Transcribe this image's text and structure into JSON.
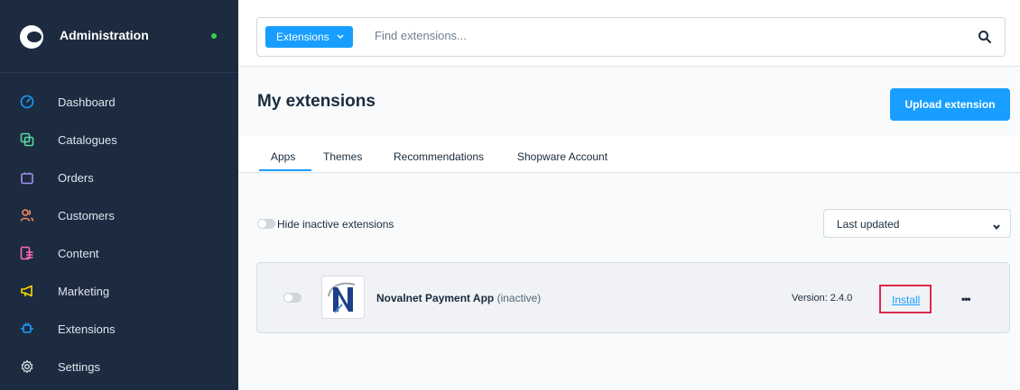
{
  "sidebar": {
    "title": "Administration",
    "status_color": "#37d046",
    "items": [
      {
        "label": "Dashboard",
        "icon": "dashboard-icon",
        "color": "#189eff"
      },
      {
        "label": "Catalogues",
        "icon": "catalogue-icon",
        "color": "#57d9a3"
      },
      {
        "label": "Orders",
        "icon": "orders-icon",
        "color": "#a092f0"
      },
      {
        "label": "Customers",
        "icon": "customers-icon",
        "color": "#f88962"
      },
      {
        "label": "Content",
        "icon": "content-icon",
        "color": "#ff68b4"
      },
      {
        "label": "Marketing",
        "icon": "marketing-icon",
        "color": "#ffd700"
      },
      {
        "label": "Extensions",
        "icon": "extensions-icon",
        "color": "#189eff"
      },
      {
        "label": "Settings",
        "icon": "settings-icon",
        "color": "#d1d9e0"
      }
    ]
  },
  "search": {
    "scope_label": "Extensions",
    "placeholder": "Find extensions..."
  },
  "page": {
    "title": "My extensions",
    "upload_label": "Upload extension",
    "tabs": [
      "Apps",
      "Themes",
      "Recommendations",
      "Shopware Account"
    ],
    "active_tab": "Apps",
    "hide_inactive_label": "Hide inactive extensions",
    "sort_value": "Last updated"
  },
  "extension": {
    "name": "Novalnet Payment App",
    "status": "(inactive)",
    "version": "Version: 2.4.0",
    "install_label": "Install",
    "more_label": "•••"
  },
  "colors": {
    "accent": "#189eff",
    "sidebar_bg": "#1c2b40",
    "highlight": "#de294c"
  }
}
